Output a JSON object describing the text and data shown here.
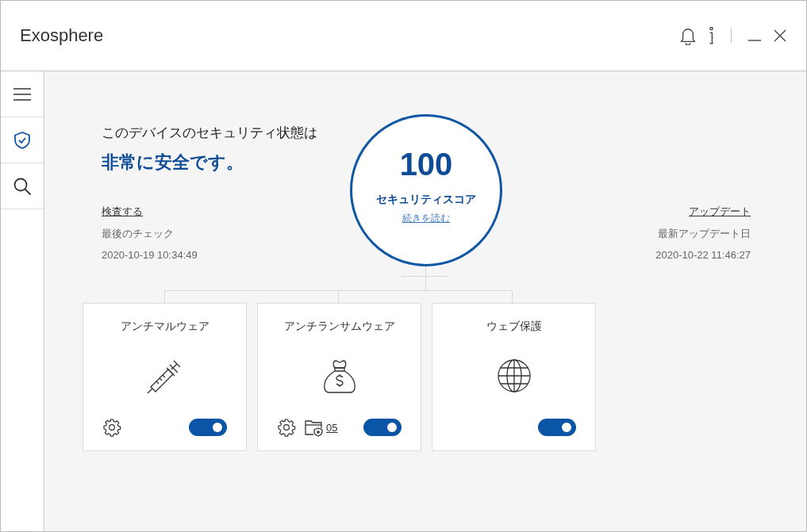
{
  "window": {
    "title": "Exosphere"
  },
  "sidebar": {
    "items": [
      {
        "kind": "menu",
        "selected": false
      },
      {
        "kind": "shield",
        "selected": true
      },
      {
        "kind": "search",
        "selected": false
      }
    ]
  },
  "status": {
    "heading": "このデバイスのセキュリティ状態は",
    "verdict": "非常に安全です。",
    "scan": {
      "link": "検査する",
      "label": "最後のチェック",
      "date": "2020-10-19 10:34:49"
    },
    "update": {
      "link": "アップデート",
      "label": "最新アップデート日",
      "date": "2020-10-22 11:46:27"
    },
    "score": {
      "value": "100",
      "label": "セキュリティスコア",
      "link": "続きを読む"
    }
  },
  "cards": [
    {
      "title": "アンチマルウェア",
      "kind": "syringe",
      "settings": true,
      "on": true
    },
    {
      "title": "アンチランサムウェア",
      "kind": "money-bag",
      "settings": true,
      "folder_count": "05",
      "on": true
    },
    {
      "title": "ウェブ保護",
      "kind": "globe",
      "settings": false,
      "on": true
    }
  ]
}
